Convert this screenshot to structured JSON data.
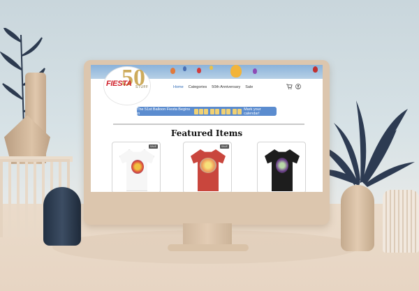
{
  "site": {
    "logo": {
      "brand": "FIESTA",
      "number": "50",
      "sub": "STUFF"
    },
    "nav": [
      "Home",
      "Categories",
      "50th Anniversary",
      "Sale"
    ],
    "banner": {
      "before": "The 51st Balloon Fiesta Begins in",
      "after": "Mark your calendar!"
    },
    "featured_title": "Featured Items",
    "products": [
      {
        "badge": "SALE",
        "shirt_color": "#f6f6f6"
      },
      {
        "badge": "SALE",
        "shirt_color": "#c9463d"
      },
      {
        "badge": "",
        "shirt_color": "#1d1d1d"
      }
    ]
  },
  "colors": {
    "accent": "#5b8ccf",
    "logo_red": "#d0202a",
    "logo_gold": "#c8a24a"
  }
}
